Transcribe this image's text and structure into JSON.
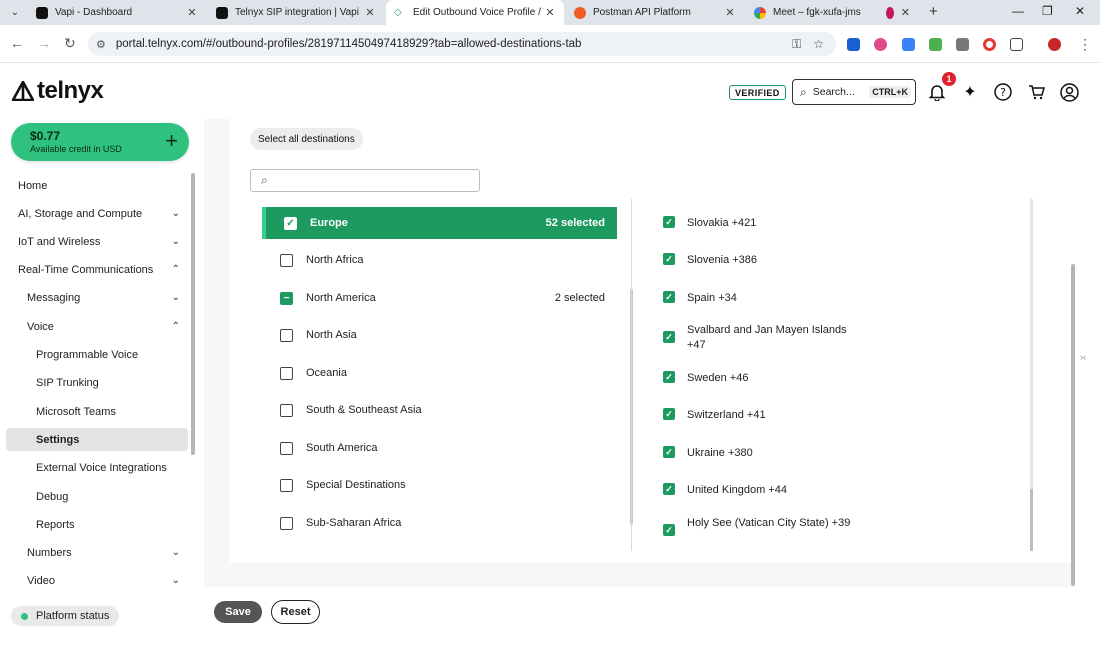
{
  "browser": {
    "tabs": [
      {
        "title": "Vapi - Dashboard",
        "active": false
      },
      {
        "title": "Telnyx SIP integration | Vapi",
        "active": false
      },
      {
        "title": "Edit Outbound Voice Profile / T",
        "active": true
      },
      {
        "title": "Postman API Platform",
        "active": false
      },
      {
        "title": "Meet – fgk-xufa-jms",
        "active": false
      }
    ],
    "url": "portal.telnyx.com/#/outbound-profiles/2819711450497418929?tab=allowed-destinations-tab"
  },
  "header": {
    "logo": "telnyx",
    "verified": "VERIFIED",
    "search_placeholder": "Search...",
    "search_shortcut": "CTRL+K",
    "notification_count": "1"
  },
  "sidebar": {
    "credit_amount": "$0.77",
    "credit_label": "Available credit in USD",
    "items": [
      {
        "label": "Home"
      },
      {
        "label": "AI, Storage and Compute"
      },
      {
        "label": "IoT and Wireless"
      },
      {
        "label": "Real-Time Communications"
      },
      {
        "label": "Messaging"
      },
      {
        "label": "Voice"
      },
      {
        "label": "Programmable Voice"
      },
      {
        "label": "SIP Trunking"
      },
      {
        "label": "Microsoft Teams"
      },
      {
        "label": "Settings"
      },
      {
        "label": "External Voice Integrations"
      },
      {
        "label": "Debug"
      },
      {
        "label": "Reports"
      },
      {
        "label": "Numbers"
      },
      {
        "label": "Video"
      }
    ],
    "platform_status": "Platform status"
  },
  "main": {
    "select_all_label": "Select all destinations",
    "search_placeholder": "",
    "regions": [
      {
        "name": "Europe",
        "count": "52 selected",
        "state": "checked"
      },
      {
        "name": "North Africa",
        "count": "",
        "state": "unchecked"
      },
      {
        "name": "North America",
        "count": "2 selected",
        "state": "partial"
      },
      {
        "name": "North Asia",
        "count": "",
        "state": "unchecked"
      },
      {
        "name": "Oceania",
        "count": "",
        "state": "unchecked"
      },
      {
        "name": "South & Southeast Asia",
        "count": "",
        "state": "unchecked"
      },
      {
        "name": "South America",
        "count": "",
        "state": "unchecked"
      },
      {
        "name": "Special Destinations",
        "count": "",
        "state": "unchecked"
      },
      {
        "name": "Sub-Saharan Africa",
        "count": "",
        "state": "unchecked"
      }
    ],
    "countries": [
      {
        "name": "Slovakia +421",
        "checked": true
      },
      {
        "name": "Slovenia +386",
        "checked": true
      },
      {
        "name": "Spain +34",
        "checked": true
      },
      {
        "name": "Svalbard and Jan Mayen Islands +47",
        "checked": true
      },
      {
        "name": "Sweden +46",
        "checked": true
      },
      {
        "name": "Switzerland +41",
        "checked": true
      },
      {
        "name": "Ukraine +380",
        "checked": true
      },
      {
        "name": "United Kingdom +44",
        "checked": true
      },
      {
        "name": "Holy See (Vatican City State) +39",
        "checked": true
      }
    ],
    "save_label": "Save",
    "reset_label": "Reset"
  },
  "colors": {
    "accent": "#1d9a5f",
    "credit_bg": "#2ec27e",
    "badge": "#e0202c"
  }
}
